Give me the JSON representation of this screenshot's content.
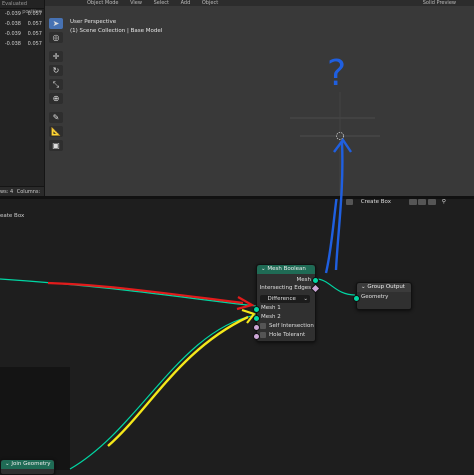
{
  "spreadsheet": {
    "header_eval": "Evaluated",
    "col_header": "position",
    "rows": [
      [
        "-0.039",
        "0.057"
      ],
      [
        "-0.038",
        "0.057"
      ],
      [
        "-0.039",
        "0.057"
      ],
      [
        "-0.038",
        "0.057"
      ]
    ],
    "footer_rows": "ws: 4",
    "footer_columns": "Columns:"
  },
  "viewport": {
    "menu": [
      "Object Mode",
      "View",
      "Select",
      "Add",
      "Object"
    ],
    "shading": "Solid Preview",
    "perspective": "User Perspective",
    "collection": "(1) Scene Collection | Base Model",
    "annotation": "?"
  },
  "node_editor": {
    "tree_label": "eate Box",
    "toolbar_name": "Create Box",
    "mesh_boolean": {
      "title": "Mesh Boolean",
      "output_mesh": "Mesh",
      "output_edges": "Intersecting Edges",
      "mode": "Difference",
      "inputs": [
        "Mesh 1",
        "Mesh 2",
        "Self Intersection",
        "Hole Tolerant"
      ]
    },
    "group_output": {
      "title": "Group Output",
      "socket": "Geometry"
    },
    "join_geometry": {
      "title": "Join Geometry"
    }
  },
  "colors": {
    "geometry_socket": "#00d6a3",
    "bool_socket": "#cca6d6",
    "geometry_node_header": "#1f6b55",
    "output_node_header": "#3b3b3b",
    "annotation_red": "#e21b1b",
    "annotation_yellow": "#f5e81a",
    "annotation_blue": "#1f5fe0",
    "active_tool": "#4772b3"
  }
}
